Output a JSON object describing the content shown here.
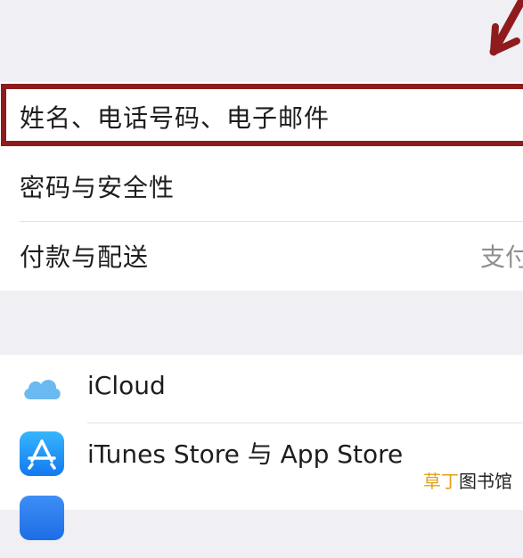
{
  "account_rows": [
    {
      "label": "姓名、电话号码、电子邮件",
      "value": ""
    },
    {
      "label": "密码与安全性",
      "value": ""
    },
    {
      "label": "付款与配送",
      "value": "支付"
    }
  ],
  "service_rows": [
    {
      "label": "iCloud",
      "icon": "icloud-icon"
    },
    {
      "label": "iTunes Store 与 App Store",
      "icon": "app-store-icon"
    },
    {
      "label": "",
      "icon": "app-icon"
    }
  ],
  "watermark": {
    "part1": "草丁",
    "part2": "图书馆"
  },
  "colors": {
    "highlight": "#8e1c1c",
    "background": "#efeff4"
  }
}
